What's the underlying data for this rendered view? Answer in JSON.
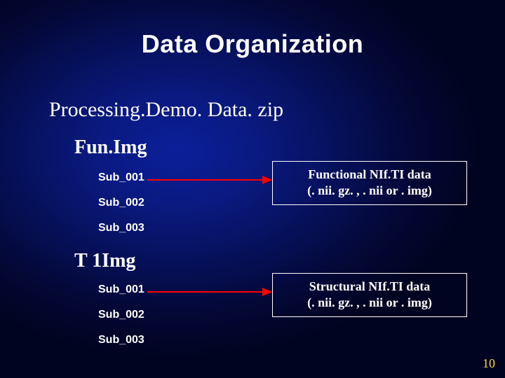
{
  "title": "Data Organization",
  "subtitle": "Processing.Demo. Data. zip",
  "funimg": {
    "heading": "Fun.Img",
    "subs": [
      "Sub_001",
      "Sub_002",
      "Sub_003"
    ]
  },
  "t1img": {
    "heading": "T 1Img",
    "subs": [
      "Sub_001",
      "Sub_002",
      "Sub_003"
    ]
  },
  "callouts": {
    "functional": {
      "line1": "Functional NIf.TI data",
      "line2": "(. nii. gz. , . nii or . img)"
    },
    "structural": {
      "line1": "Structural NIf.TI data",
      "line2": "(. nii. gz. , . nii or . img)"
    }
  },
  "arrow_color": "#ff0000",
  "page_number": "10"
}
